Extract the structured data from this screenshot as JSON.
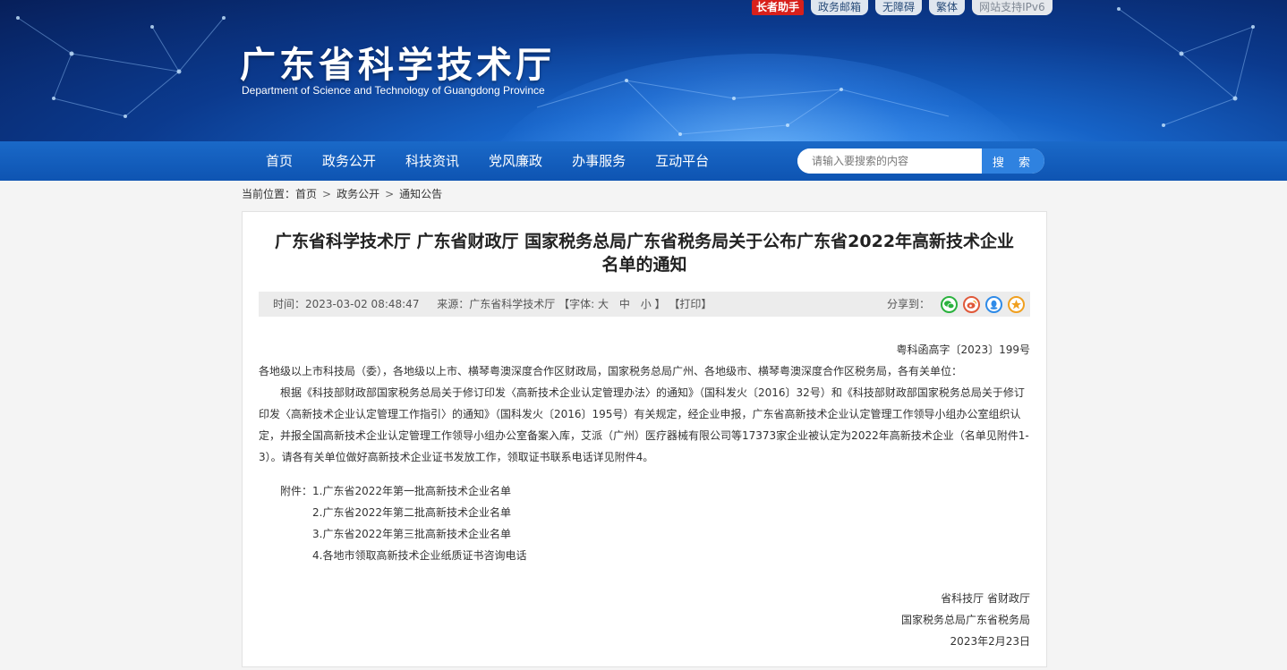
{
  "header": {
    "title": "广东省科学技术厅",
    "subtitle": "Department of Science and Technology of Guangdong Province",
    "top_links": [
      "长者助手",
      "政务邮箱",
      "无障碍",
      "繁体",
      "网站支持IPv6"
    ]
  },
  "nav": {
    "items": [
      "首页",
      "政务公开",
      "科技资讯",
      "党风廉政",
      "办事服务",
      "互动平台"
    ],
    "search_placeholder": "请输入要搜索的内容",
    "search_button": "搜 索"
  },
  "breadcrumb": {
    "prefix": "当前位置：",
    "items": [
      "首页",
      "政务公开",
      "通知公告"
    ],
    "separator": ">"
  },
  "article": {
    "title_line1": "广东省科学技术厅 广东省财政厅 国家税务总局广东省税务局关于公布广东省2022年高新技术企业",
    "title_line2": "名单的通知",
    "meta": {
      "time": "时间：2023-03-02 08:48:47",
      "source": "来源：广东省科学技术厅",
      "font_label": "【字体:",
      "font_large": "大",
      "font_medium": "中",
      "font_small": "小",
      "font_close": "】",
      "print": "【打印】",
      "share_label": "分享到："
    },
    "doc_number": "粤科函高字〔2023〕199号",
    "recipients": "各地级以上市科技局（委），各地级以上市、横琴粤澳深度合作区财政局，国家税务总局广州、各地级市、横琴粤澳深度合作区税务局，各有关单位：",
    "body_line1": "根据《科技部财政部国家税务总局关于修订印发〈高新技术企业认定管理办法〉的通知》（国科发火〔2016〕32号）和《科技部财政部国家税务总局关于修订",
    "body_line2": "印发〈高新技术企业认定管理工作指引〉的通知》（国科发火〔2016〕195号）有关规定，经企业申报，广东省高新技术企业认定管理工作领导小组办公室组织认",
    "body_line3": "定，并报全国高新技术企业认定管理工作领导小组办公室备案入库，艾派（广州）医疗器械有限公司等17373家企业被认定为2022年高新技术企业（名单见附件1-",
    "body_line4": "3）。请各有关单位做好高新技术企业证书发放工作，领取证书联系电话详见附件4。",
    "attachments_label": "附件：",
    "attachments": [
      "1.广东省2022年第一批高新技术企业名单",
      "2.广东省2022年第二批高新技术企业名单",
      "3.广东省2022年第三批高新技术企业名单",
      "4.各地市领取高新技术企业纸质证书咨询电话"
    ],
    "signature": [
      "省科技厅 省财政厅",
      "国家税务总局广东省税务局",
      "2023年2月23日"
    ]
  }
}
